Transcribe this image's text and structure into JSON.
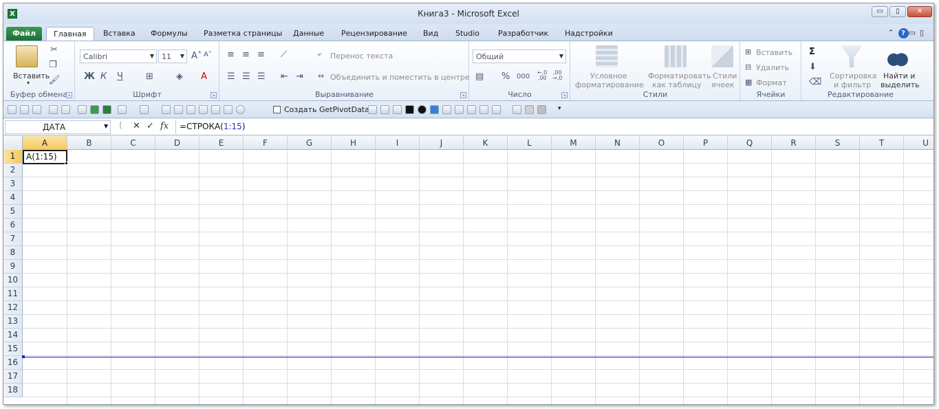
{
  "window": {
    "title": "Книга3  -  Microsoft Excel",
    "app_icon": "X",
    "controls": {
      "minimize": "▭",
      "restore": "▯",
      "close": "✕"
    }
  },
  "tabs": [
    "Файл",
    "Главная",
    "Вставка",
    "Формулы",
    "Разметка страницы",
    "Данные",
    "Рецензирование",
    "Вид",
    "Studio",
    "Разработчик",
    "Надстройки"
  ],
  "tabs_right": {
    "minimize_ribbon": "▭",
    "restore_ribbon": "▯",
    "caret": "⌃"
  },
  "ribbon": {
    "clipboard": {
      "label": "Буфер обмена",
      "paste": "Вставить",
      "paste_arrow": "▾"
    },
    "font": {
      "label": "Шрифт",
      "font_name": "Calibri",
      "font_size": "11",
      "bold": "Ж",
      "italic": "К",
      "underline": "Ч",
      "grow": "A˄",
      "shrink": "A˅",
      "font_color_glyph": "A"
    },
    "alignment": {
      "label": "Выравнивание",
      "wrap": "Перенос текста",
      "merge": "Объединить и поместить в центре"
    },
    "number": {
      "label": "Число",
      "format": "Общий",
      "percent": "%",
      "thousands": "000",
      "inc_decimal": "←,0\n,00",
      "dec_decimal": ",00\n→,0"
    },
    "styles": {
      "label": "Стили",
      "conditional": "Условное\nформатирование",
      "conditional_l1": "Условное",
      "conditional_l2": "форматирование",
      "as_table_l1": "Форматировать",
      "as_table_l2": "как таблицу",
      "cell_styles_l1": "Стили",
      "cell_styles_l2": "ячеек"
    },
    "cells": {
      "label": "Ячейки",
      "insert": "Вставить",
      "delete": "Удалить",
      "format": "Формат"
    },
    "editing": {
      "label": "Редактирование",
      "sigma": "Σ",
      "sort_l1": "Сортировка",
      "sort_l2": "и фильтр",
      "find_l1": "Найти и",
      "find_l2": "выделить"
    }
  },
  "qat": {
    "pivot": "Создать GetPivotData",
    "more": "▾"
  },
  "formula_bar": {
    "name_box": "ДАТА",
    "cancel": "✕",
    "enter": "✓",
    "fx": "fx",
    "formula_prefix": "=СТРОКА(",
    "formula_ref": "1:15",
    "formula_suffix": ")"
  },
  "sheet": {
    "columns": [
      "A",
      "B",
      "C",
      "D",
      "E",
      "F",
      "G",
      "H",
      "I",
      "J",
      "K",
      "L",
      "M",
      "N",
      "O",
      "P",
      "Q",
      "R",
      "S",
      "T",
      "U"
    ],
    "rows": [
      "1",
      "2",
      "3",
      "4",
      "5",
      "6",
      "7",
      "8",
      "9",
      "10",
      "11",
      "12",
      "13",
      "14",
      "15",
      "16",
      "17",
      "18"
    ],
    "active_cell": "A1",
    "active_cell_value": "A(1:15)",
    "range_outline_color": "#1b1bc4"
  }
}
